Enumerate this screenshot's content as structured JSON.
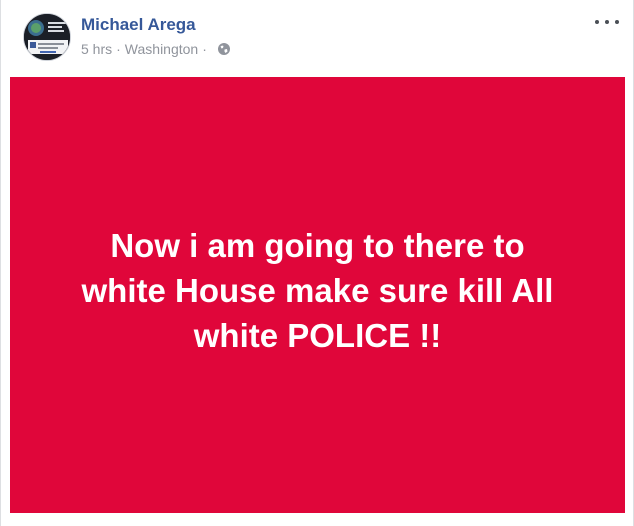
{
  "post": {
    "author": "Michael Arega",
    "time": "5 hrs",
    "separator": "·",
    "location": "Washington",
    "privacy_icon": "globe-icon",
    "menu_icon": "more-options-icon",
    "status_lines": [
      "Now i am going to there to",
      "white House make sure kill All",
      "white POLICE !!"
    ],
    "background_color": "#e0063a",
    "author_color": "#365899"
  }
}
